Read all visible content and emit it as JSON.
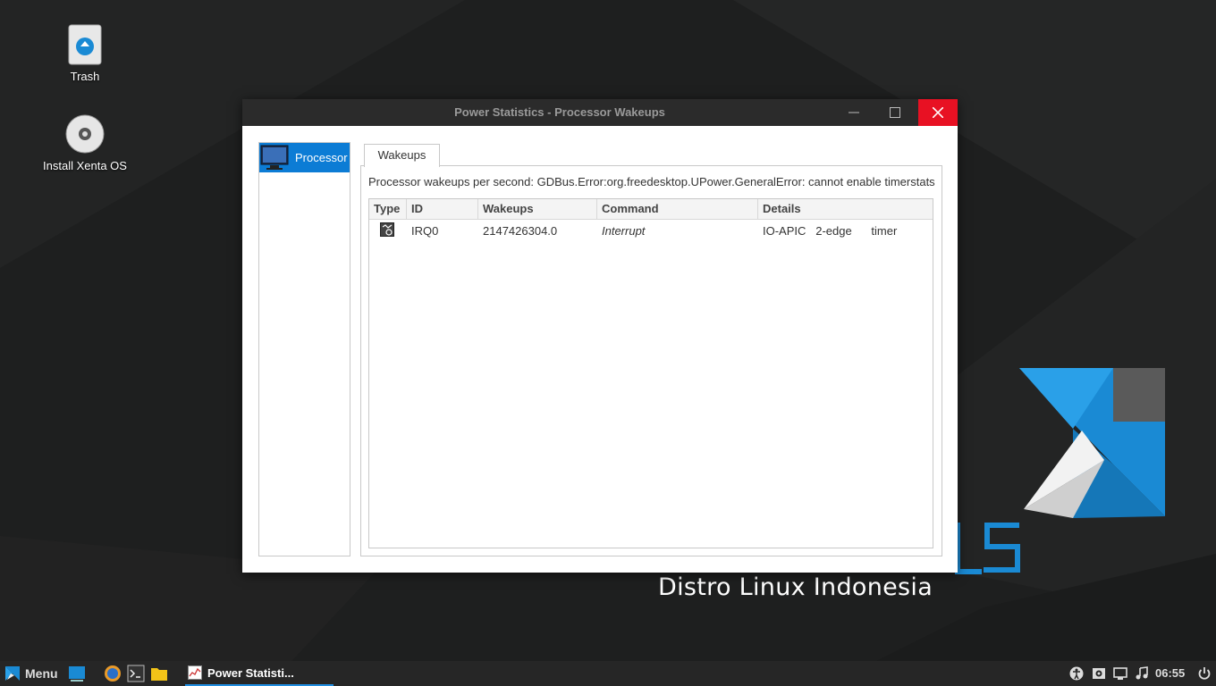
{
  "desktop": {
    "icons": [
      {
        "label": "Trash"
      },
      {
        "label": "Install Xenta OS"
      }
    ],
    "brand_tagline": "Distro Linux Indonesia",
    "accent_color": "#1a8ad4"
  },
  "window": {
    "title": "Power Statistics - Processor Wakeups",
    "sidebar_items": [
      {
        "label": "Processor",
        "icon": "monitor-icon"
      }
    ],
    "tab_label": "Wakeups",
    "message": "Processor wakeups per second: GDBus.Error:org.freedesktop.UPower.GeneralError: cannot enable timerstats",
    "table": {
      "columns": [
        "Type",
        "ID",
        "Wakeups",
        "Command",
        "Details"
      ],
      "rows": [
        {
          "type_icon": "interrupt-icon",
          "id": "IRQ0",
          "wakeups": "2147426304.0",
          "command": "Interrupt",
          "details": "IO-APIC   2-edge      timer"
        }
      ]
    },
    "close_color": "#e81123",
    "selection_color": "#0c7cd5"
  },
  "taskbar": {
    "menu_label": "Menu",
    "launchers": [
      "show-desktop-icon",
      "browser-icon",
      "terminal-icon",
      "files-icon"
    ],
    "task_label": "Power Statisti...",
    "tray_icons": [
      "accessibility-icon",
      "screenshot-icon",
      "network-icon",
      "music-icon",
      "power-icon"
    ],
    "clock": "06:55"
  }
}
